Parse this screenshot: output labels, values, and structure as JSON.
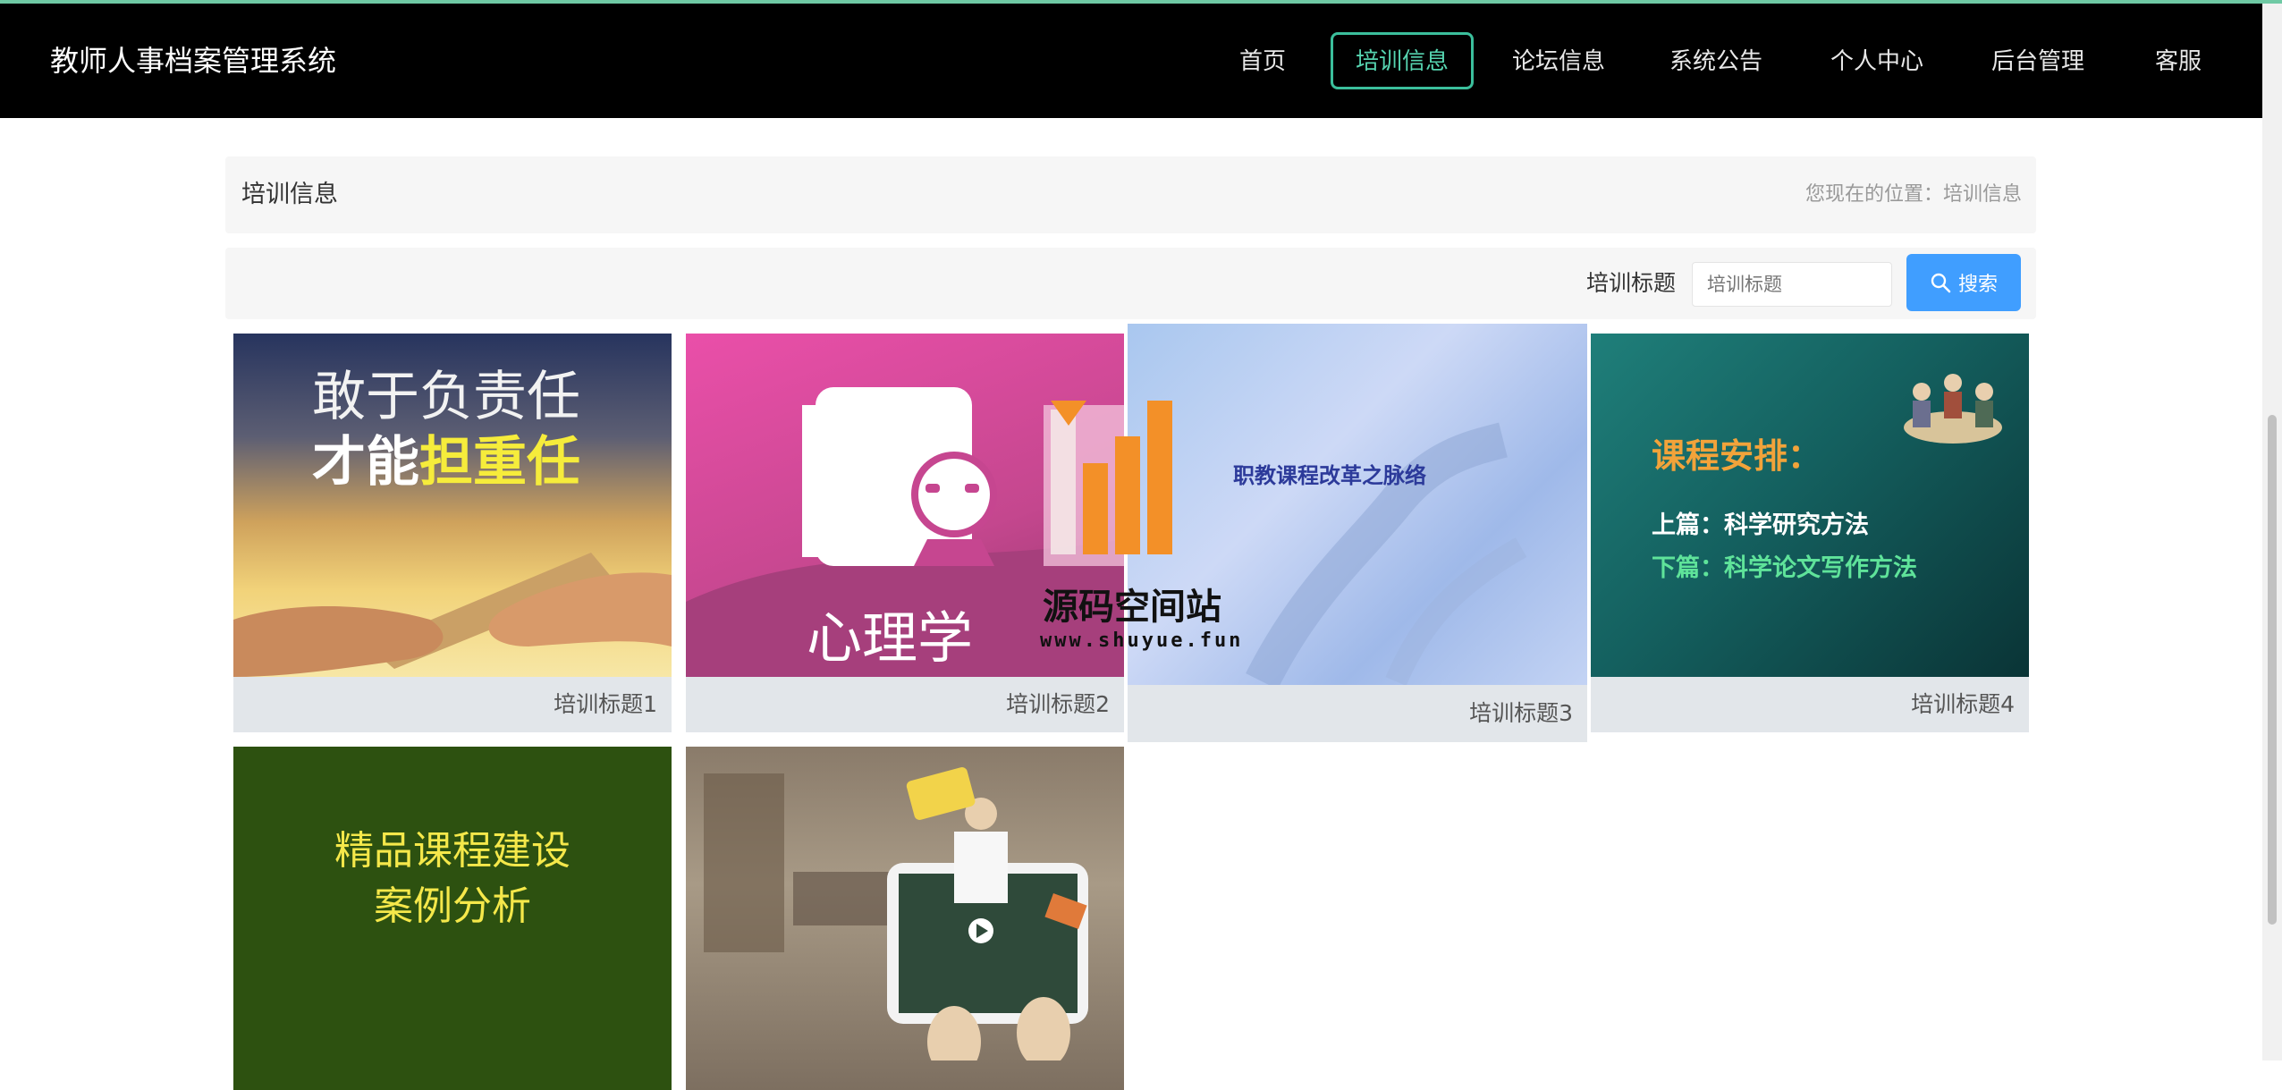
{
  "header": {
    "brand": "教师人事档案管理系统",
    "nav": [
      {
        "label": "首页",
        "active": false
      },
      {
        "label": "培训信息",
        "active": true
      },
      {
        "label": "论坛信息",
        "active": false
      },
      {
        "label": "系统公告",
        "active": false
      },
      {
        "label": "个人中心",
        "active": false
      },
      {
        "label": "后台管理",
        "active": false
      },
      {
        "label": "客服",
        "active": false
      }
    ]
  },
  "breadcrumb": {
    "title": "培训信息",
    "location_prefix": "您现在的位置：",
    "location": "培训信息"
  },
  "search": {
    "label": "培训标题",
    "placeholder": "培训标题",
    "button_label": "搜索"
  },
  "cards": [
    {
      "title": "培训标题1",
      "image_text": [
        "敢于负责任",
        "才能",
        "担重任"
      ]
    },
    {
      "title": "培训标题2",
      "image_text": [
        "心理学"
      ]
    },
    {
      "title": "培训标题3",
      "image_text": [
        "职教课程改革之脉络"
      ]
    },
    {
      "title": "培训标题4",
      "image_text": [
        "课程安排：",
        "上篇：科学研究方法",
        "下篇：科学论文写作方法"
      ]
    },
    {
      "title": "",
      "image_text": [
        "精品课程建设",
        "案例分析"
      ]
    },
    {
      "title": "",
      "image_text": []
    }
  ],
  "watermark": {
    "name": "源码空间站",
    "url": "www.shuyue.fun"
  },
  "colors": {
    "navbar": "#000000",
    "active_nav": "#3bbf9c",
    "search_button": "#409eff"
  }
}
